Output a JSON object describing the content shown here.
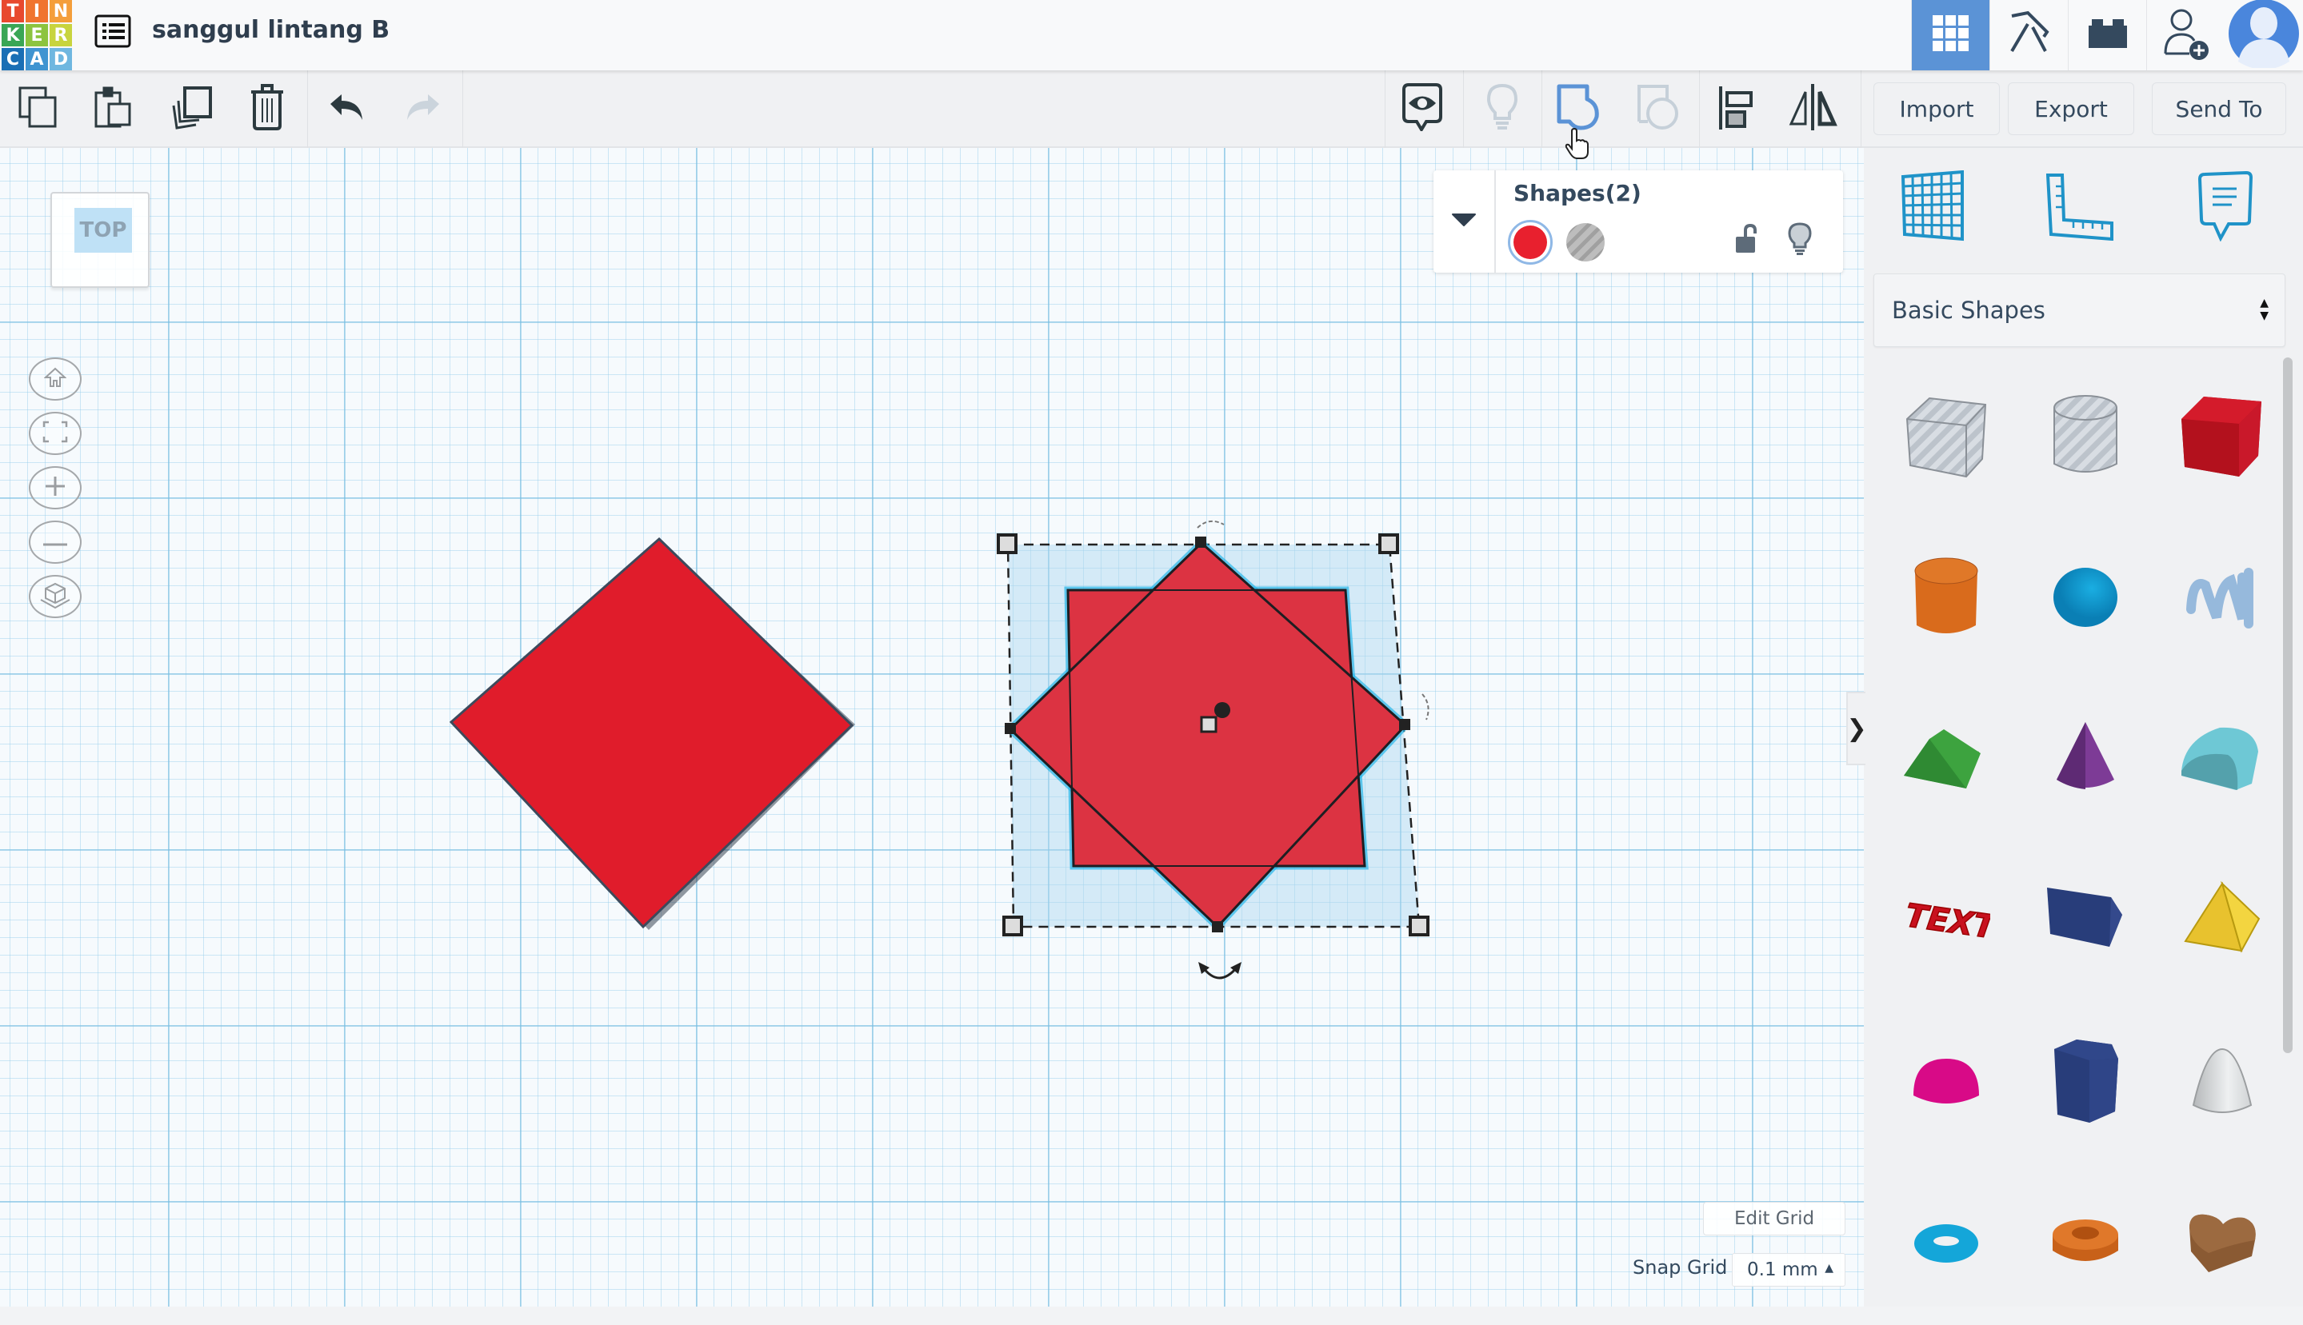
{
  "app": {
    "logo_letters": [
      "T",
      "I",
      "N",
      "K",
      "E",
      "R",
      "C",
      "A",
      "D"
    ],
    "logo_colors": [
      "#e8492e",
      "#f0742f",
      "#f49e3a",
      "#3aa655",
      "#8cc43f",
      "#c8d43e",
      "#1a6fb5",
      "#3f94d1",
      "#6fb7e0"
    ],
    "title": "sanggul lintang B"
  },
  "header": {
    "menu_icon": "list-icon",
    "right_buttons": [
      {
        "name": "3d-design-view",
        "icon": "grid-icon",
        "active": true
      },
      {
        "name": "blocks-view",
        "icon": "pickaxe-icon",
        "active": false
      },
      {
        "name": "bricks-view",
        "icon": "brick-icon",
        "active": false
      },
      {
        "name": "invite-user",
        "icon": "user-plus-icon",
        "active": false
      },
      {
        "name": "profile",
        "icon": "avatar-icon",
        "active": false
      }
    ]
  },
  "toolbar": {
    "left_tools": [
      {
        "name": "copy",
        "icon": "copy-icon"
      },
      {
        "name": "paste",
        "icon": "paste-icon"
      },
      {
        "name": "duplicate",
        "icon": "duplicate-icon"
      },
      {
        "name": "delete",
        "icon": "trash-icon"
      },
      {
        "name": "undo",
        "icon": "undo-icon"
      },
      {
        "name": "redo",
        "icon": "redo-icon",
        "disabled": true
      }
    ],
    "right_tools": [
      {
        "name": "notes",
        "icon": "eye-note-icon"
      },
      {
        "name": "show-all",
        "icon": "lightbulb-icon",
        "disabled": true
      },
      {
        "name": "group",
        "icon": "group-icon",
        "active": true
      },
      {
        "name": "ungroup",
        "icon": "ungroup-icon",
        "disabled": true
      },
      {
        "name": "align",
        "icon": "align-icon"
      },
      {
        "name": "mirror",
        "icon": "mirror-icon"
      }
    ],
    "import_label": "Import",
    "export_label": "Export",
    "send_to_label": "Send To"
  },
  "viewport": {
    "viewcube_label": "TOP",
    "nav_buttons": [
      "home-icon",
      "fit-view-icon",
      "zoom-in-icon",
      "zoom-out-icon",
      "perspective-icon"
    ],
    "edit_grid_label": "Edit Grid",
    "snap_grid_label": "Snap Grid",
    "snap_grid_value": "0.1 mm"
  },
  "inspector": {
    "title": "Shapes(2)",
    "solid_color": "#e8202e",
    "selected": "solid",
    "hole_label": "hole"
  },
  "scene": {
    "shape_color": "#e01c2b",
    "group_color": "#dc3342",
    "selection_color": "#29b6e8"
  },
  "library": {
    "tools": [
      "workplane-icon",
      "ruler-icon",
      "notes-icon"
    ],
    "category": "Basic Shapes",
    "shapes": [
      {
        "name": "Box Hole",
        "icon": "box-hole-icon"
      },
      {
        "name": "Cylinder Hole",
        "icon": "cylinder-hole-icon"
      },
      {
        "name": "Box",
        "icon": "box-icon"
      },
      {
        "name": "Cylinder",
        "icon": "cylinder-icon"
      },
      {
        "name": "Sphere",
        "icon": "sphere-icon"
      },
      {
        "name": "Scribble",
        "icon": "scribble-icon"
      },
      {
        "name": "Roof",
        "icon": "roof-icon"
      },
      {
        "name": "Cone",
        "icon": "cone-icon"
      },
      {
        "name": "Round Roof",
        "icon": "round-roof-icon"
      },
      {
        "name": "Text",
        "icon": "text-icon"
      },
      {
        "name": "Wedge",
        "icon": "wedge-icon"
      },
      {
        "name": "Pyramid",
        "icon": "pyramid-icon"
      },
      {
        "name": "Half Sphere",
        "icon": "half-sphere-icon"
      },
      {
        "name": "Polygon",
        "icon": "polygon-icon"
      },
      {
        "name": "Paraboloid",
        "icon": "paraboloid-icon"
      },
      {
        "name": "Torus",
        "icon": "torus-icon"
      },
      {
        "name": "Tube",
        "icon": "tube-icon"
      },
      {
        "name": "Heart",
        "icon": "heart-icon"
      }
    ]
  }
}
